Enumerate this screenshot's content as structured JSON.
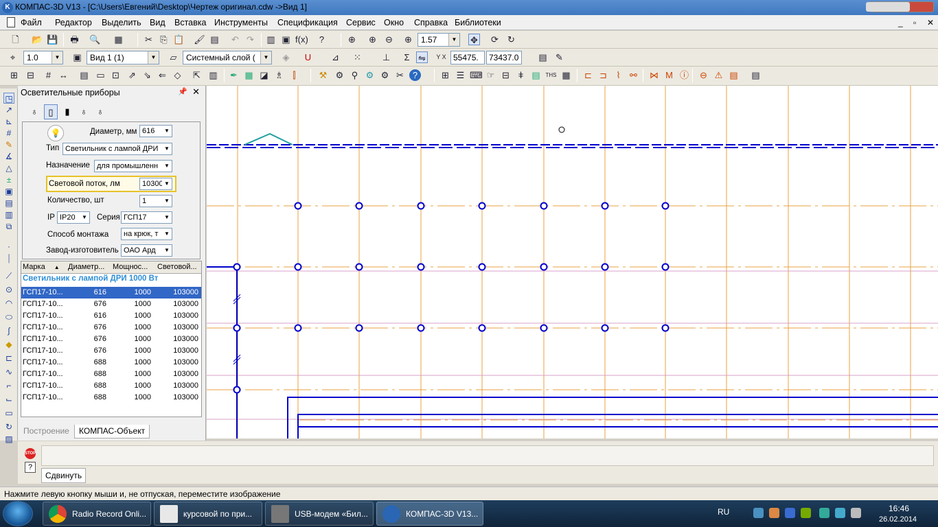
{
  "window": {
    "title": "КОМПАС-3D V13 - [C:\\Users\\Евгений\\Desktop\\Чертеж оригинал.cdw ->Вид 1]"
  },
  "menu": [
    "Файл",
    "Редактор",
    "Выделить",
    "Вид",
    "Вставка",
    "Инструменты",
    "Спецификация",
    "Сервис",
    "Окно",
    "Справка",
    "Библиотеки"
  ],
  "toolbar1": {
    "zoom": "1.57"
  },
  "toolbar2": {
    "step": "1.0",
    "view": "Вид 1 (1)",
    "layer": "Системный слой (",
    "coord_x": "55475.",
    "coord_y": "73437.0"
  },
  "panel": {
    "title": "Осветительные приборы",
    "props": {
      "diameter_label": "Диаметр, мм",
      "diameter_value": "616",
      "type_label": "Тип",
      "type_value": "Светильник с лампой ДРИ",
      "purpose_label": "Назначение",
      "purpose_value": "для промышленн",
      "flux_label": "Световой поток, лм",
      "flux_value": "10300",
      "count_label": "Количество, шт",
      "count_value": "1",
      "ip_label": "IP",
      "ip_value": "IP20",
      "series_label": "Серия",
      "series_value": "ГСП17",
      "mount_label": "Способ монтажа",
      "mount_value": "на крюк, т",
      "maker_label": "Завод-изготовитель",
      "maker_value": "ОАО Ард"
    },
    "table": {
      "headers": [
        "Марка",
        "Диаметр...",
        "Мощнос...",
        "Световой..."
      ],
      "sort_glyph": "▲",
      "group": "Светильник с лампой ДРИ 1000 Вт",
      "rows": [
        [
          "ГСП17-10...",
          "616",
          "1000",
          "103000"
        ],
        [
          "ГСП17-10...",
          "676",
          "1000",
          "103000"
        ],
        [
          "ГСП17-10...",
          "616",
          "1000",
          "103000"
        ],
        [
          "ГСП17-10...",
          "676",
          "1000",
          "103000"
        ],
        [
          "ГСП17-10...",
          "676",
          "1000",
          "103000"
        ],
        [
          "ГСП17-10...",
          "676",
          "1000",
          "103000"
        ],
        [
          "ГСП17-10...",
          "688",
          "1000",
          "103000"
        ],
        [
          "ГСП17-10...",
          "688",
          "1000",
          "103000"
        ],
        [
          "ГСП17-10...",
          "688",
          "1000",
          "103000"
        ],
        [
          "ГСП17-10...",
          "688",
          "1000",
          "103000"
        ]
      ]
    },
    "tabs": [
      "Построение",
      "КОМПАС-Объект"
    ]
  },
  "command": {
    "tab_label": "Сдвинуть",
    "stop_label": "STOP",
    "help_label": "?"
  },
  "status": "Нажмите левую кнопку мыши и, не отпуская, переместите изображение",
  "taskbar": {
    "tasks": [
      "Radio Record Onli...",
      "курсовой по при...",
      "USB-модем «Бил...",
      "КОМПАС-3D V13..."
    ],
    "lang": "RU",
    "time": "16:46",
    "date": "26.02.2014"
  },
  "colors": {
    "grid_orange": "#e8a040",
    "lines_blue": "#0000cc",
    "accent_teal": "#20a0a0"
  }
}
